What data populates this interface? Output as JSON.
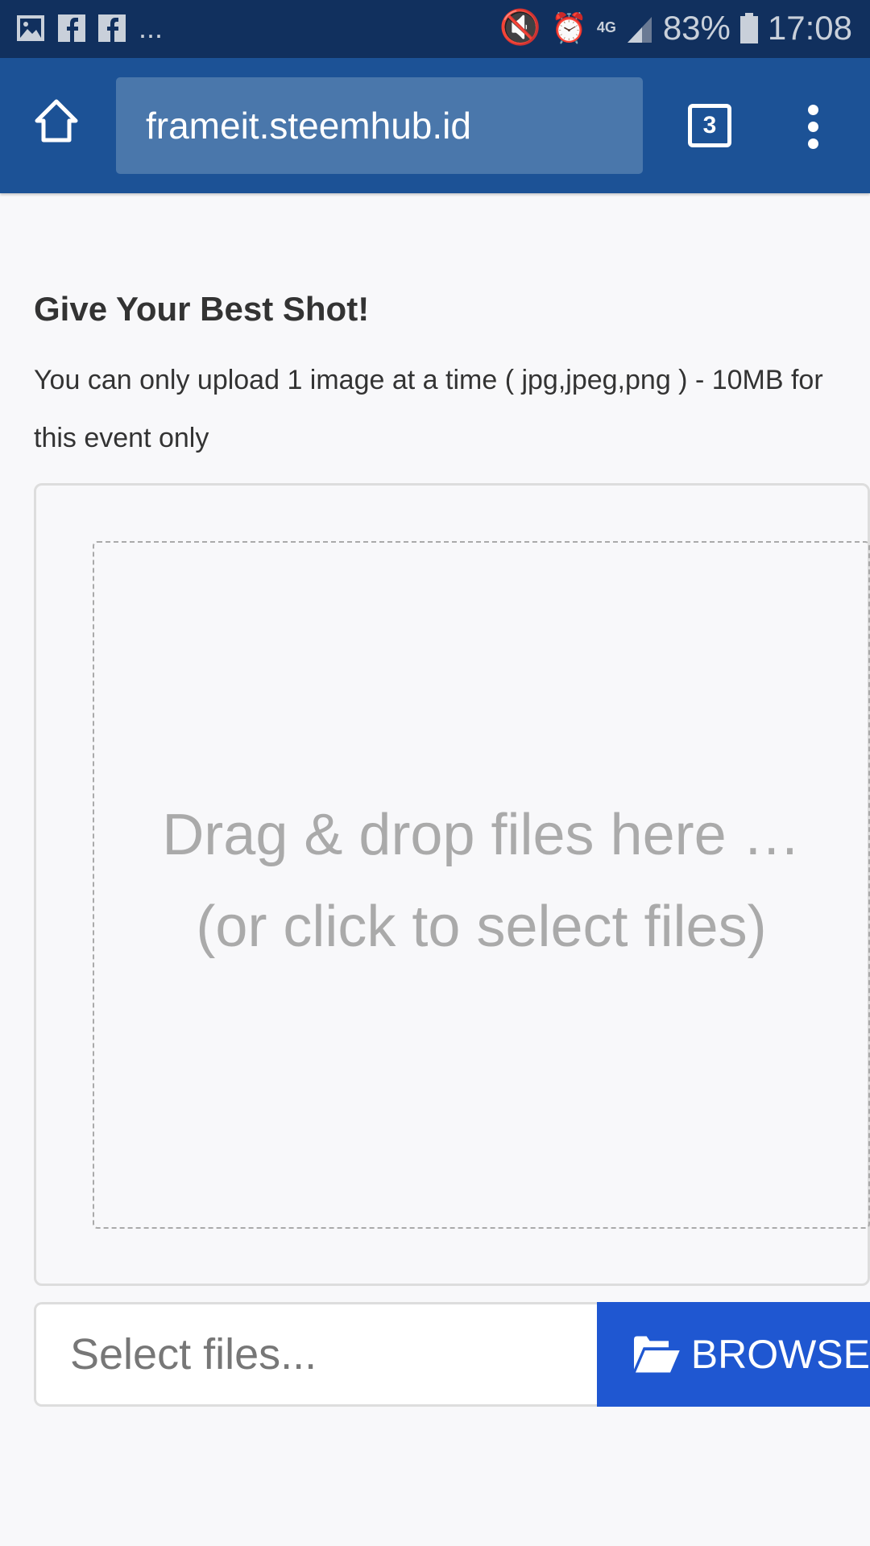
{
  "status_bar": {
    "left_icons": [
      "image-icon",
      "facebook-icon",
      "facebook-icon"
    ],
    "more": "...",
    "network": "4G",
    "battery": "83%",
    "time": "17:08"
  },
  "browser": {
    "url": "frameit.steemhub.id",
    "tab_count": "3"
  },
  "page": {
    "title": "Give Your Best Shot!",
    "subtitle": "You can only upload 1 image at a time ( jpg,jpeg,png ) - 10MB for this event only",
    "drop_line1": "Drag & drop files here …",
    "drop_line2": "(or click to select files)",
    "file_placeholder": "Select files...",
    "browse_label": "BROWSE"
  },
  "colors": {
    "status_bar": "#11305e",
    "toolbar": "#1c5296",
    "browse": "#1f57d1"
  }
}
